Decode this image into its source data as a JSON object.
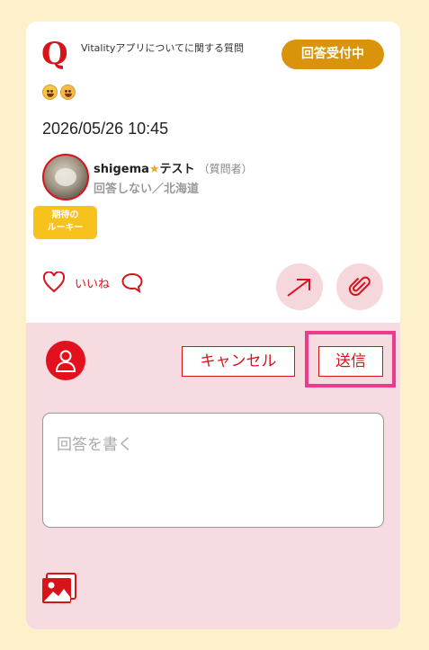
{
  "question": {
    "mark": "Q",
    "title": "Vitalityアプリについてに関する質問",
    "status": "回答受付中",
    "emojis": [
      "grinning-face",
      "smiling-face-with-blush"
    ],
    "timestamp": "2026/05/26 10:45"
  },
  "author": {
    "name": "shigema",
    "star": "★",
    "name_suffix": "テスト",
    "role": "（質問者）",
    "sub": "回答しない／北海道",
    "badge_line1": "期待の",
    "badge_line2": "ルーキー"
  },
  "actions": {
    "like_label": "いいね"
  },
  "answer_form": {
    "cancel_label": "キャンセル",
    "send_label": "送信",
    "placeholder": "回答を書く"
  },
  "colors": {
    "accent": "#d7141a",
    "status_badge": "#d9940b",
    "rookie_badge": "#f8c21c",
    "panel": "#f6dbe0",
    "highlight": "#ee3a8a",
    "background": "#fdf1cc"
  }
}
